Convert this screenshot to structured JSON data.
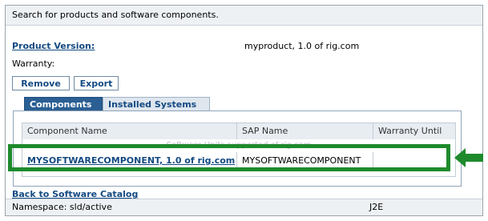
{
  "header": {
    "text": "Search for products and software components."
  },
  "product_version": {
    "label": "Product Version:",
    "value": "myproduct, 1.0 of rig.com"
  },
  "warranty": {
    "label": "Warranty:"
  },
  "buttons": {
    "remove": "Remove",
    "export": "Export"
  },
  "tabs": [
    {
      "label": "Components"
    },
    {
      "label": "Installed Systems"
    }
  ],
  "table": {
    "columns": [
      "Component Name",
      "SAP Name",
      "Warranty Until"
    ],
    "faint_text": "Software Units supported of rig.com",
    "row": {
      "component": "MYSOFTWARECOMPONENT, 1.0 of rig.com",
      "sap_name": "MYSOFTWARECOMPONENT",
      "warranty_until": ""
    }
  },
  "back_link": "Back to Software Catalog",
  "footer": {
    "namespace": "Namespace: sld/active",
    "system": "J2E"
  },
  "colors": {
    "highlight": "#1e8a2c",
    "link": "#144a82",
    "active_tab": "#2b5f93"
  }
}
